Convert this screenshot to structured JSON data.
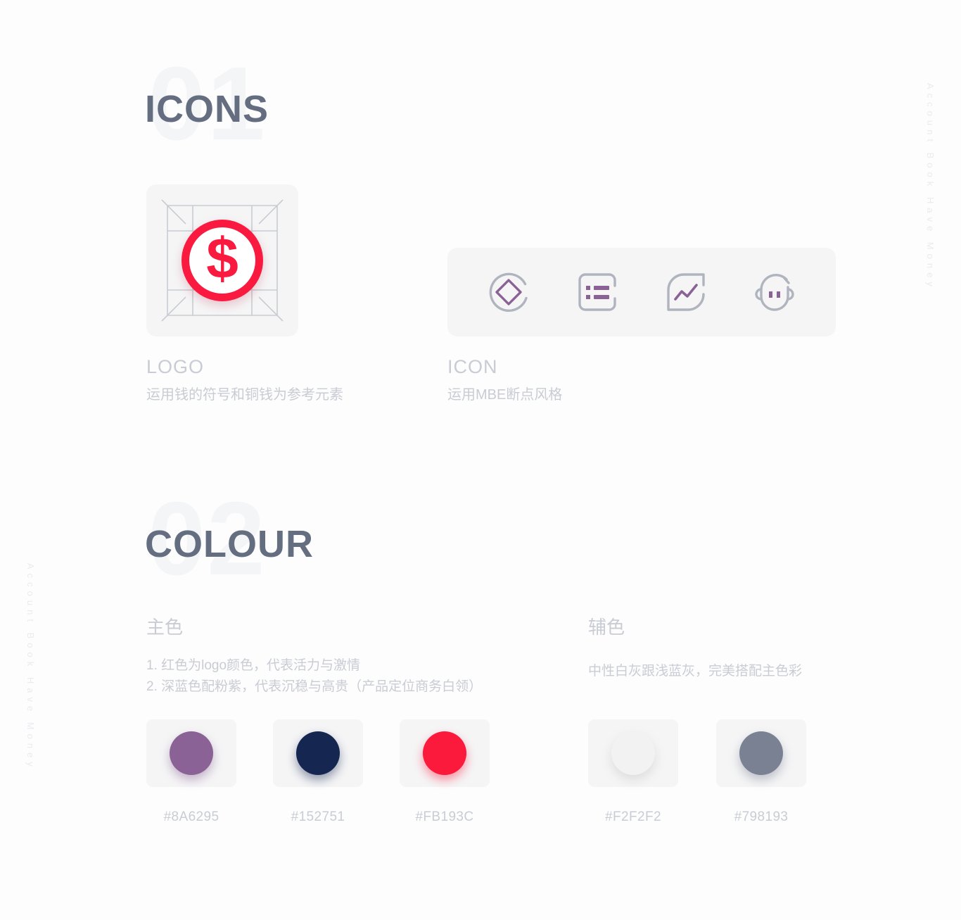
{
  "side_tag": {
    "text": "Account Book Have Money"
  },
  "sections": [
    {
      "number": "01",
      "title": "ICONS"
    },
    {
      "number": "02",
      "title": "COLOUR"
    }
  ],
  "icons_section": {
    "logo": {
      "caption_title": "LOGO",
      "caption_desc": "运用钱的符号和铜钱为参考元素",
      "symbol": "$",
      "coin_color": "#FB1A3F",
      "grid_color": "#C8CCD2",
      "panel_bg": "#F5F5F6"
    },
    "icon_set": {
      "caption_title": "ICON",
      "caption_desc": "运用MBE断点风格",
      "panel_bg": "#F5F5F6",
      "stroke_color": "#AFB4BE",
      "accent_color": "#8A6295",
      "items": [
        {
          "name": "diamond-in-circle-icon",
          "label": "diamond"
        },
        {
          "name": "list-icon",
          "label": "list"
        },
        {
          "name": "trend-chart-icon",
          "label": "chart"
        },
        {
          "name": "face-icon",
          "label": "face"
        }
      ]
    }
  },
  "colour_section": {
    "primary": {
      "title": "主色",
      "lines": [
        "1. 红色为logo颜色，代表活力与激情",
        "2. 深蓝色配粉紫，代表沉稳与高贵（产品定位商务白领）"
      ],
      "swatches": [
        {
          "hex": "#8A6295",
          "glow": "rgba(138,98,149,0.45)"
        },
        {
          "hex": "#152751",
          "glow": "rgba(21,39,81,0.45)"
        },
        {
          "hex": "#FB193C",
          "glow": "rgba(251,25,60,0.45)"
        }
      ]
    },
    "secondary": {
      "title": "辅色",
      "lines": [
        "中性白灰跟浅蓝灰，完美搭配主色彩"
      ],
      "swatches": [
        {
          "hex": "#F2F2F2",
          "glow": "rgba(170,170,170,0.30)"
        },
        {
          "hex": "#798193",
          "glow": "rgba(121,129,147,0.45)"
        }
      ]
    }
  }
}
